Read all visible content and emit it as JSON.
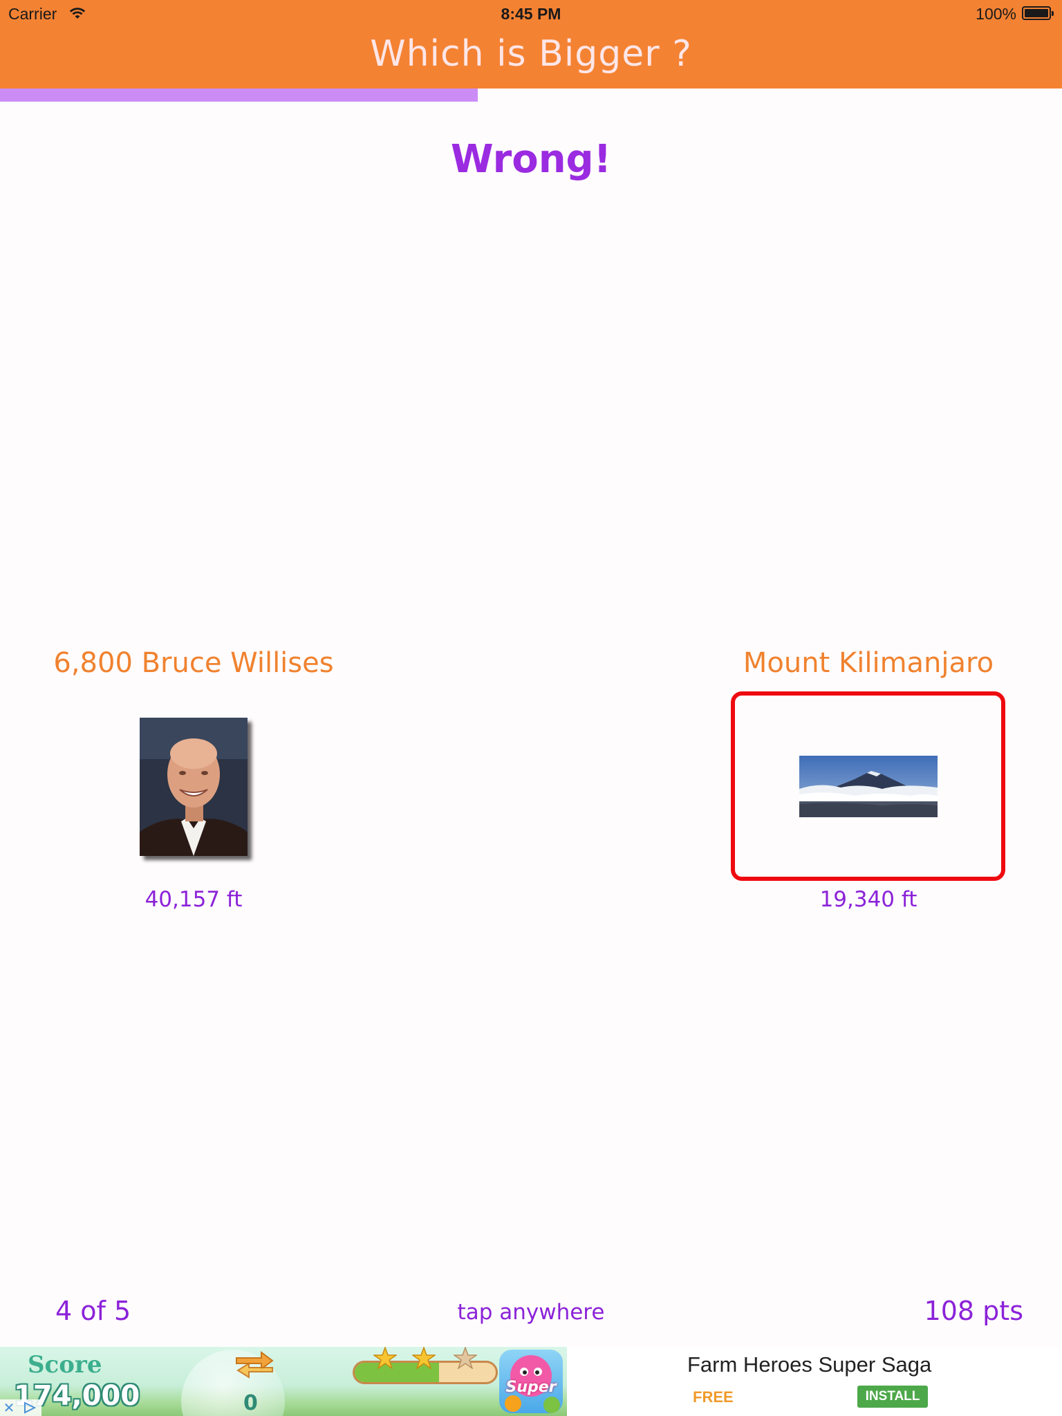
{
  "status_bar": {
    "carrier": "Carrier",
    "time": "8:45 PM",
    "battery_percent": "100%"
  },
  "header": {
    "title": "Which is Bigger ?"
  },
  "progress": {
    "fraction": 0.45,
    "color": "#cc8cf5"
  },
  "result": {
    "text": "Wrong!"
  },
  "left_item": {
    "name": "6,800 Bruce Willises",
    "value": "40,157 ft",
    "image": "bruce-willis-photo"
  },
  "right_item": {
    "name": "Mount Kilimanjaro",
    "value": "19,340 ft",
    "image": "mount-kilimanjaro-photo",
    "selected": true
  },
  "footer": {
    "question_counter": "4 of 5",
    "hint": "tap anywhere",
    "points": "108 pts"
  },
  "ad": {
    "score_label": "Score",
    "score_value": "174,000",
    "counter_value": "0",
    "app_icon_text": "Super",
    "title": "Farm Heroes Super Saga",
    "price": "FREE",
    "install_label": "INSTALL"
  },
  "colors": {
    "header": "#f48233",
    "accent_purple": "#9a2be0",
    "label_orange": "#f0822f",
    "selection_red": "#ee0a10"
  }
}
